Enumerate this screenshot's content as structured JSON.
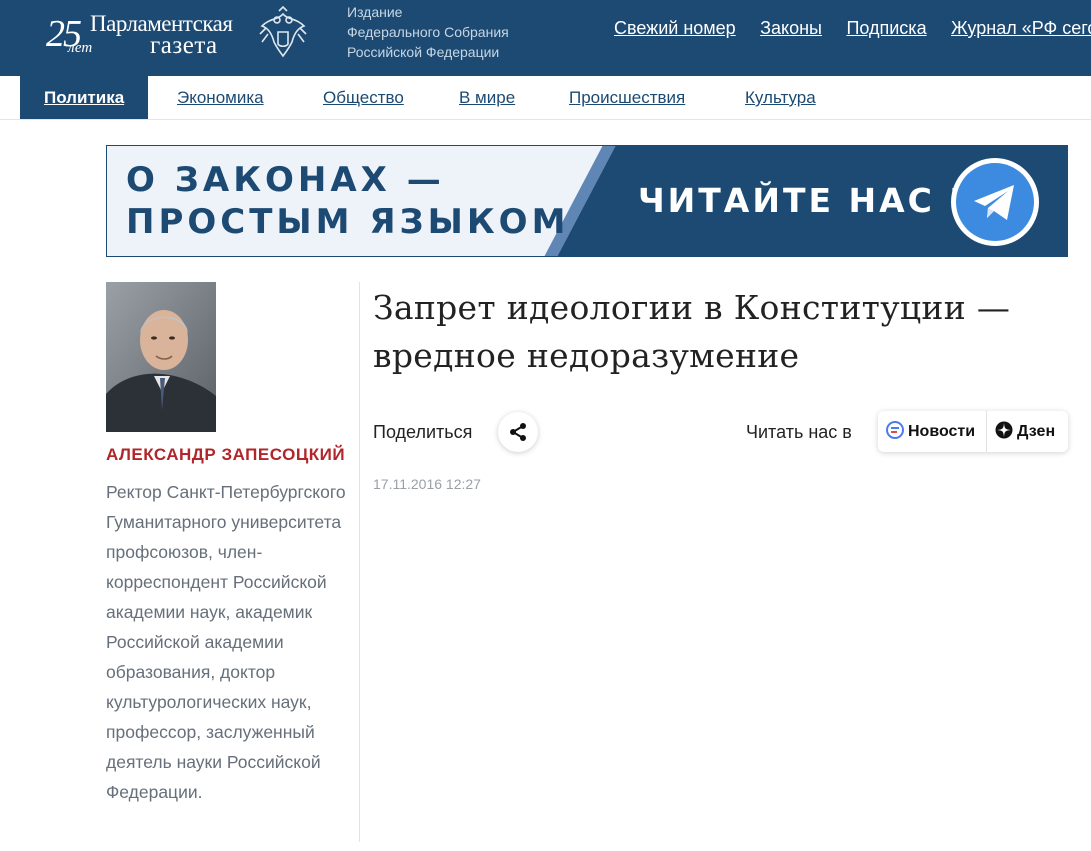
{
  "header": {
    "logo": {
      "years_number": "25",
      "years_word": "лет",
      "name_line1": "Парламентская",
      "name_line2": "газета"
    },
    "publisher_lines": [
      "Издание",
      "Федерального Собрания",
      "Российской Федерации"
    ],
    "top_links": [
      "Свежий номер",
      "Законы",
      "Подписка",
      "Журнал «РФ сегодня»"
    ]
  },
  "nav": {
    "items": [
      "Политика",
      "Экономика",
      "Общество",
      "В мире",
      "Происшествия",
      "Культура"
    ],
    "active": "Политика"
  },
  "banner": {
    "left_line1": "О ЗАКОНАХ —",
    "left_line2": "ПРОСТЫМ ЯЗЫКОМ",
    "right_text": "ЧИТАЙТЕ НАС В",
    "icon": "telegram-icon"
  },
  "author": {
    "name": "АЛЕКСАНДР ЗАПЕСОЦКИЙ",
    "bio": "Ректор Санкт-Петербургского Гуманитарного университета профсоюзов, член-корреспондент Российской академии наук, академик Российской академии образования, доктор культурологических наук, профессор, заслуженный деятель науки Российской Федерации."
  },
  "article": {
    "title": "Запрет идеологии в Конституции — вредное недоразумение",
    "share_label": "Поделиться",
    "read_label": "Читать нас в",
    "feed_news": "Новости",
    "feed_dzen": "Дзен",
    "date": "17.11.2016 12:27"
  },
  "colors": {
    "brand_blue": "#1d4a73",
    "author_red": "#b0262a",
    "telegram_blue": "#3d8be0",
    "banner_light": "#eef3f9"
  }
}
